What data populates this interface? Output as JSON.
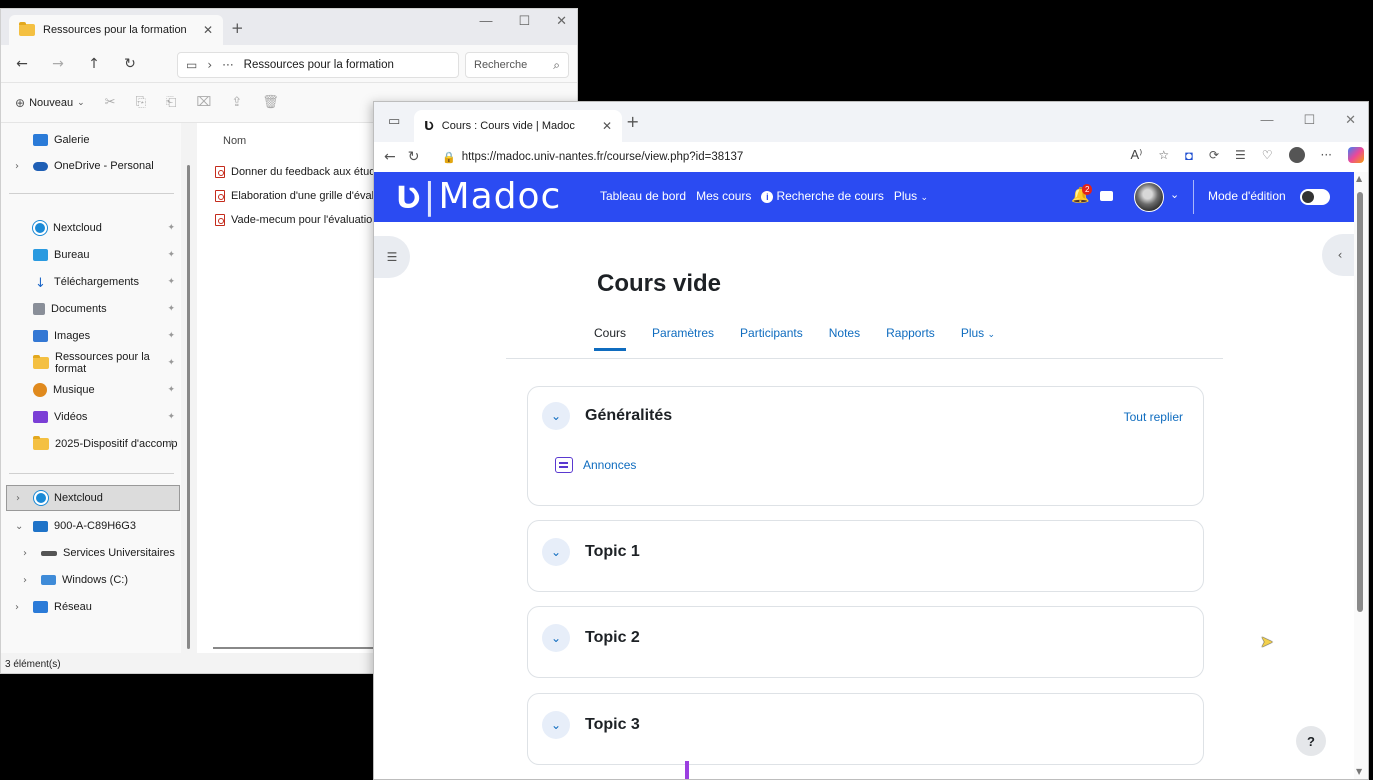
{
  "explorer": {
    "tab_title": "Ressources pour la formation",
    "address": {
      "path": "Ressources pour la formation",
      "ellipsis": "···"
    },
    "search_placeholder": "Recherche",
    "toolbar": {
      "new_label": "Nouveau"
    },
    "sidebar": [
      {
        "label": "Galerie",
        "icon": "gallery-icon"
      },
      {
        "label": "OneDrive - Personal",
        "icon": "cloud-icon"
      },
      {
        "label": "Nextcloud",
        "icon": "nextcloud-icon"
      },
      {
        "label": "Bureau",
        "icon": "desktop-icon"
      },
      {
        "label": "Téléchargements",
        "icon": "download-icon"
      },
      {
        "label": "Documents",
        "icon": "documents-icon"
      },
      {
        "label": "Images",
        "icon": "images-icon"
      },
      {
        "label": "Ressources pour la format",
        "icon": "folder-icon"
      },
      {
        "label": "Musique",
        "icon": "music-icon"
      },
      {
        "label": "Vidéos",
        "icon": "videos-icon"
      },
      {
        "label": "2025-Dispositif d'accomp",
        "icon": "folder-icon"
      },
      {
        "label": "Nextcloud",
        "icon": "nextcloud-icon"
      },
      {
        "label": "900-A-C89H6G3",
        "icon": "computer-icon"
      },
      {
        "label": "Services Universitaires",
        "icon": "network-drive-icon"
      },
      {
        "label": "Windows (C:)",
        "icon": "windows-drive-icon"
      },
      {
        "label": "Réseau",
        "icon": "network-icon"
      }
    ],
    "column_name": "Nom",
    "files": [
      "Donner du feedback aux étudiants",
      "Elaboration d'une grille d'évaluation",
      "Vade-mecum pour l'évaluation"
    ],
    "status": "3 élément(s)"
  },
  "browser": {
    "tab_title": "Cours : Cours vide | Madoc",
    "url": "https://madoc.univ-nantes.fr/course/view.php?id=38137",
    "read_aloud": "A⁾"
  },
  "madoc": {
    "logo_text": "Madoc",
    "nav": {
      "dashboard": "Tableau de bord",
      "my_courses": "Mes cours",
      "course_search": "Recherche de cours",
      "more": "Plus"
    },
    "notification_count": "2",
    "edit_mode_label": "Mode d'édition",
    "course_title": "Cours vide",
    "tabs": [
      {
        "label": "Cours",
        "active": true
      },
      {
        "label": "Paramètres",
        "active": false
      },
      {
        "label": "Participants",
        "active": false
      },
      {
        "label": "Notes",
        "active": false
      },
      {
        "label": "Rapports",
        "active": false
      },
      {
        "label": "Plus",
        "active": false
      }
    ],
    "sections": [
      {
        "title": "Généralités",
        "collapse_all": "Tout replier",
        "activity": "Annonces"
      },
      {
        "title": "Topic 1"
      },
      {
        "title": "Topic 2"
      },
      {
        "title": "Topic 3"
      }
    ],
    "help_label": "?"
  },
  "colors": {
    "madoc_blue": "#2b4bf2",
    "link_blue": "#0f6cbf",
    "forum_purple": "#5a39d0"
  }
}
